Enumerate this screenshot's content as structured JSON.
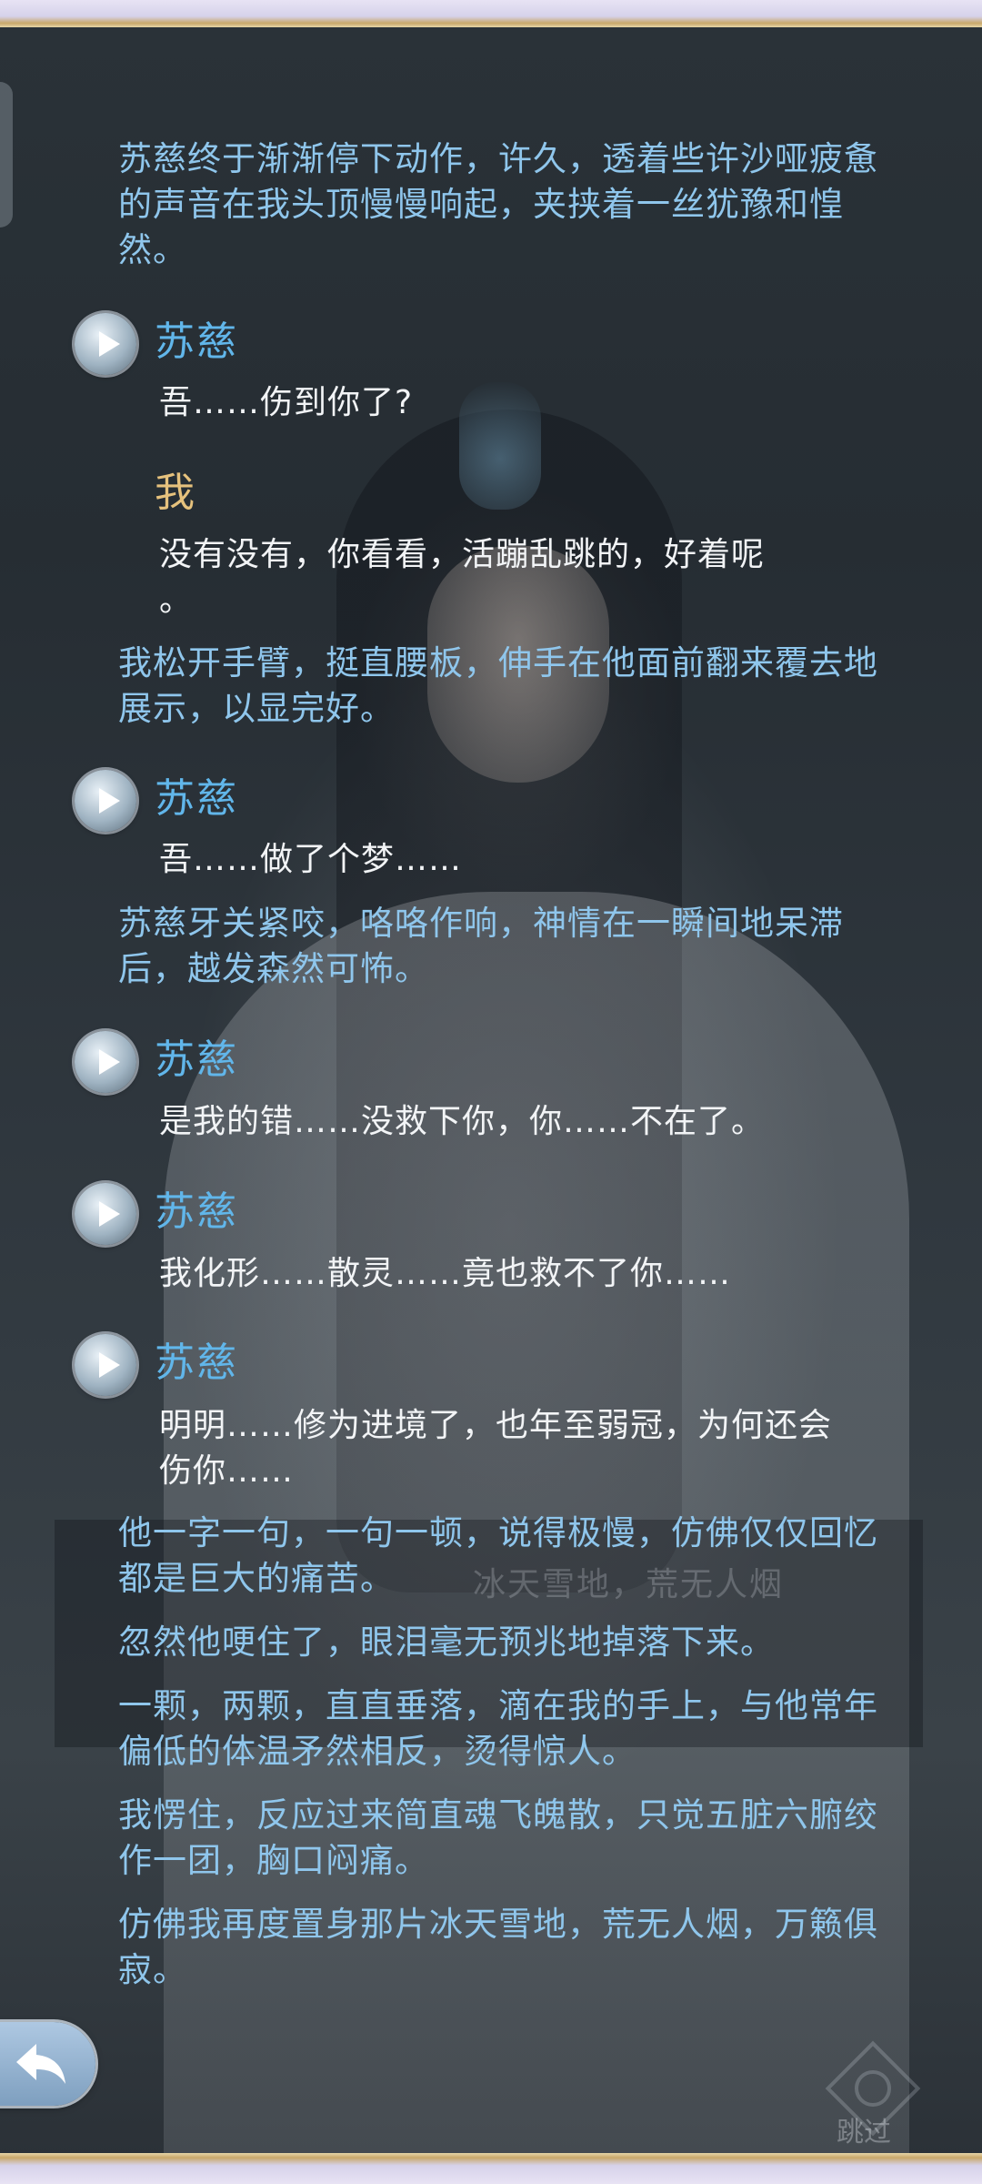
{
  "dialogue": {
    "entries": [
      {
        "kind": "narration",
        "text": "苏慈终于渐渐停下动作，许久，透着些许沙哑疲惫的声音在我头顶慢慢响起，夹挟着一丝犹豫和惶然。"
      },
      {
        "kind": "speech",
        "speaker": "苏慈",
        "text": "吾……伤到你了?"
      },
      {
        "kind": "speech",
        "speaker": "我",
        "text": "没有没有，你看看，活蹦乱跳的，好着呢\n。"
      },
      {
        "kind": "narration",
        "text": "我松开手臂，挺直腰板，伸手在他面前翻来覆去地展示，以显完好。"
      },
      {
        "kind": "speech",
        "speaker": "苏慈",
        "text": "吾……做了个梦……"
      },
      {
        "kind": "narration",
        "text": "苏慈牙关紧咬，咯咯作响，神情在一瞬间地呆滞后，越发森然可怖。"
      },
      {
        "kind": "speech",
        "speaker": "苏慈",
        "text": "是我的错……没救下你，你……不在了。"
      },
      {
        "kind": "speech",
        "speaker": "苏慈",
        "text": "我化形……散灵……竟也救不了你……"
      },
      {
        "kind": "speech",
        "speaker": "苏慈",
        "text": "明明……修为进境了，也年至弱冠，为何还会伤你……"
      },
      {
        "kind": "narration",
        "text": "他一字一句，一句一顿，说得极慢，仿佛仅仅回忆都是巨大的痛苦。"
      },
      {
        "kind": "narration",
        "text": "忽然他哽住了，眼泪毫无预兆地掉落下来。"
      },
      {
        "kind": "narration",
        "text": "一颗，两颗，直直垂落，滴在我的手上，与他常年偏低的体温矛然相反，烫得惊人。"
      },
      {
        "kind": "narration",
        "text": "我愣住，反应过来简直魂飞魄散，只觉五脏六腑绞作一团，胸口闷痛。"
      },
      {
        "kind": "narration",
        "text": "仿佛我再度置身那片冰天雪地，荒无人烟，万籁俱寂。"
      }
    ]
  },
  "background": {
    "ghost_text": "冰天雪地，荒无人烟"
  },
  "controls": {
    "skip_label": "跳过",
    "back_icon": "return-arrow-icon",
    "play_icon": "play-voice-icon"
  },
  "colors": {
    "narration": "#8fc6ec",
    "speaker_other": "#61b6ea",
    "speaker_me": "#e6c27d",
    "speech": "#f2f4f6"
  }
}
